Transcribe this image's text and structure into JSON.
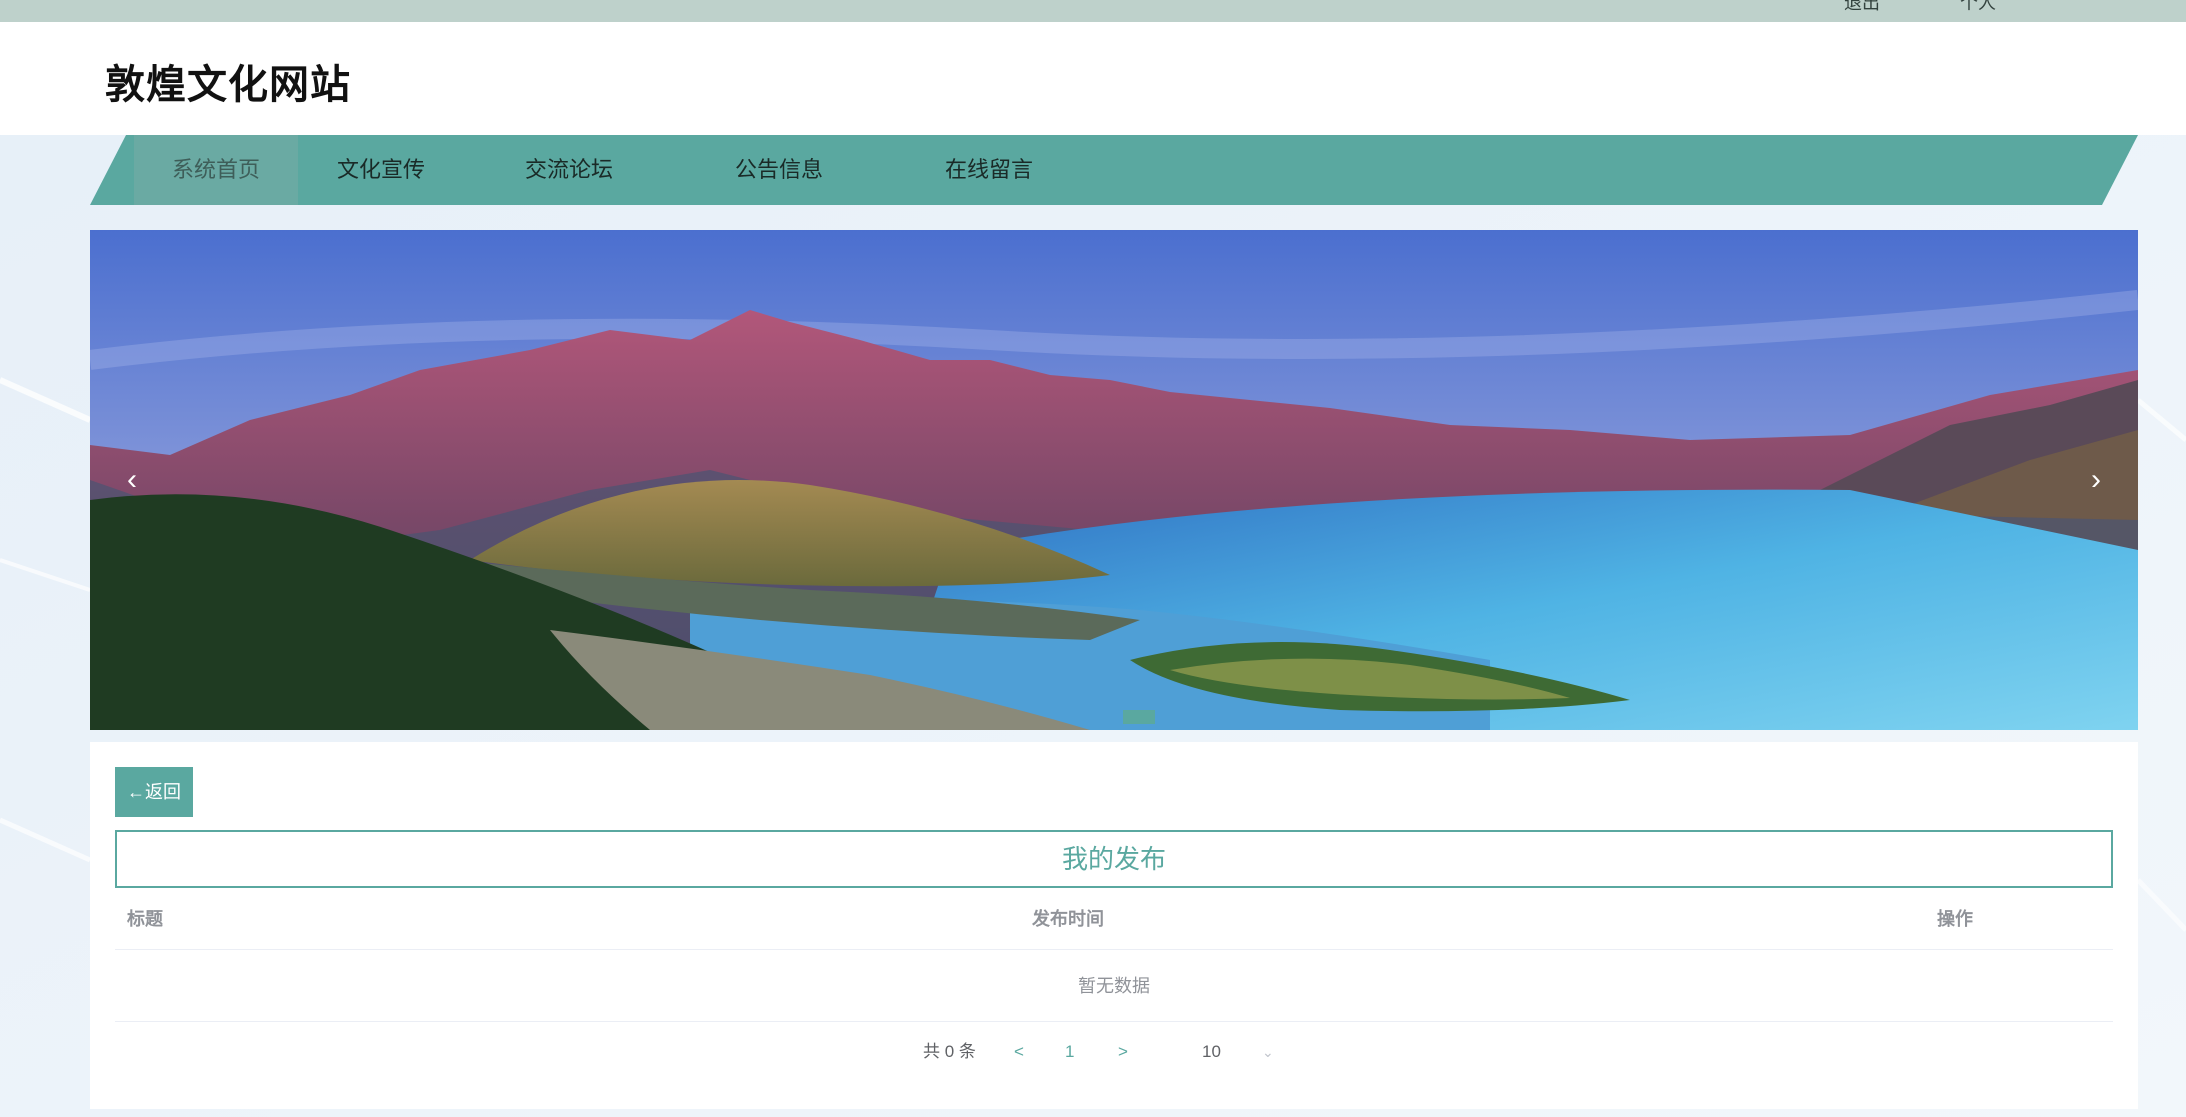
{
  "topbar": {
    "links": [
      "退出",
      "个人"
    ]
  },
  "header": {
    "site_title": "敦煌文化网站"
  },
  "nav": {
    "items": [
      {
        "label": "系统首页"
      },
      {
        "label": "文化宣传"
      },
      {
        "label": "交流论坛"
      },
      {
        "label": "公告信息"
      },
      {
        "label": "在线留言"
      }
    ],
    "active_index": 0
  },
  "banner": {
    "prev_arrow": "‹",
    "next_arrow": "›",
    "slides": 1,
    "current_slide": 1
  },
  "panel": {
    "back_label": "←返回",
    "section_title": "我的发布",
    "columns": [
      "标题",
      "发布时间",
      "操作"
    ],
    "empty_text": "暂无数据",
    "pagination": {
      "total": "共 0 条",
      "prev": "<",
      "page": "1",
      "next": ">",
      "page_size": "10"
    }
  },
  "colors": {
    "accent": "#5aa8a0",
    "topbar": "#bed1cb",
    "header_bg": "#ffffff"
  }
}
